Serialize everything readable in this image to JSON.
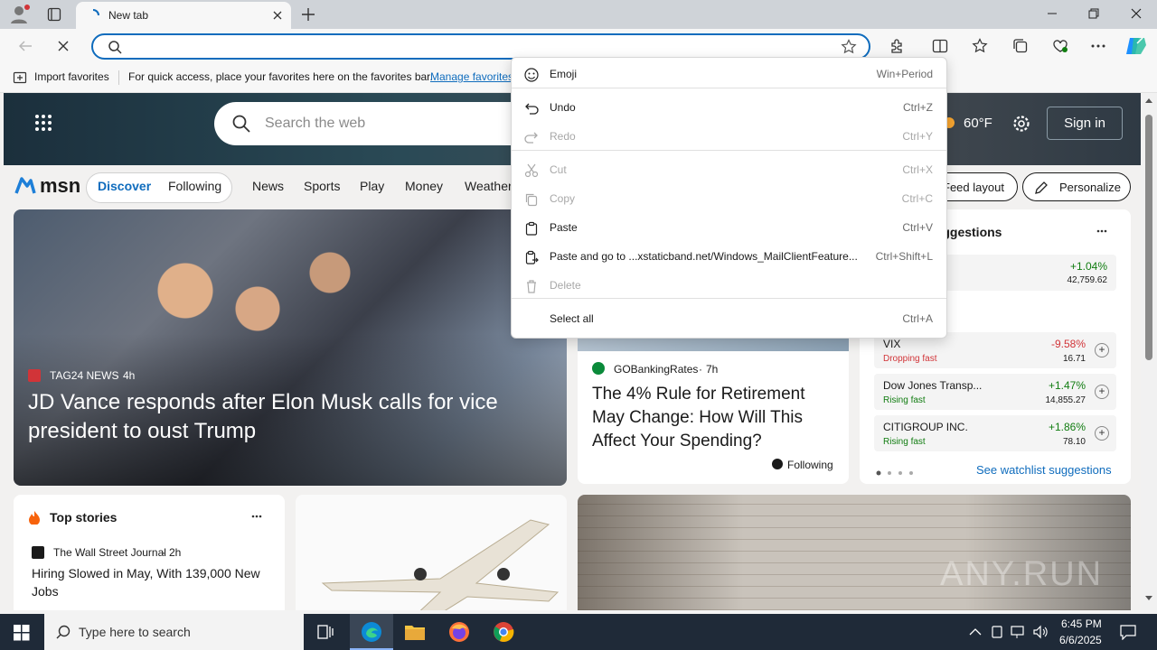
{
  "browser": {
    "tab_title": "New tab",
    "address_value": "",
    "favbar": {
      "import": "Import favorites",
      "hint": "For quick access, place your favorites here on the favorites bar.",
      "manage": "Manage favorites"
    }
  },
  "msn": {
    "search_placeholder": "Search the web",
    "weather": "60°F",
    "sign_in": "Sign in",
    "logo": "msn",
    "nav": {
      "discover": "Discover",
      "following": "Following",
      "items": [
        "News",
        "Sports",
        "Play",
        "Money",
        "Weather"
      ]
    },
    "feed_layout": "Feed layout",
    "personalize": "Personalize",
    "main_story": {
      "source": "TAG24 NEWS",
      "age": "4h",
      "headline": "JD Vance responds after Elon Musk calls for vice president to oust Trump"
    },
    "gobanking": {
      "source": "GOBankingRates",
      "age": "7h",
      "headline": "The 4% Rule for Retirement May Change: How Will This Affect Your Spending?",
      "following": "Following"
    },
    "watchlist": {
      "title": "suggestions",
      "first": {
        "change": "+1.04%",
        "value": "42,759.62"
      },
      "items": [
        {
          "name": "VIX",
          "status": "Dropping fast",
          "change": "-9.58%",
          "value": "16.71",
          "color": "#d13438"
        },
        {
          "name": "Dow Jones Transp...",
          "status": "Rising fast",
          "change": "+1.47%",
          "value": "14,855.27",
          "color": "#107c10"
        },
        {
          "name": "CITIGROUP INC.",
          "status": "Rising fast",
          "change": "+1.86%",
          "value": "78.10",
          "color": "#107c10"
        }
      ],
      "see_more": "See watchlist suggestions"
    },
    "top_stories": {
      "title": "Top stories",
      "source": "The Wall Street Journal",
      "age": "2h",
      "headline": "Hiring Slowed in May, With 139,000 New Jobs"
    }
  },
  "context_menu": {
    "items": [
      {
        "label": "Emoji",
        "shortcut": "Win+Period",
        "icon": "emoji-icon"
      },
      {
        "label": "Undo",
        "shortcut": "Ctrl+Z",
        "icon": "undo-icon"
      },
      {
        "label": "Redo",
        "shortcut": "Ctrl+Y",
        "icon": "redo-icon"
      },
      {
        "label": "Cut",
        "shortcut": "Ctrl+X",
        "icon": "cut-icon"
      },
      {
        "label": "Copy",
        "shortcut": "Ctrl+C",
        "icon": "copy-icon"
      },
      {
        "label": "Paste",
        "shortcut": "Ctrl+V",
        "icon": "paste-icon"
      },
      {
        "label": "Paste and go to ...xstaticband.net/Windows_MailClientFeature...",
        "shortcut": "Ctrl+Shift+L",
        "icon": "paste-go-icon"
      },
      {
        "label": "Delete",
        "shortcut": "",
        "icon": "delete-icon"
      },
      {
        "label": "Select all",
        "shortcut": "Ctrl+A",
        "icon": ""
      }
    ]
  },
  "taskbar": {
    "search": "Type here to search",
    "time": "6:45 PM",
    "date": "6/6/2025"
  },
  "watermark": "ANY.RUN",
  "colors": {
    "accent": "#0f6cbd",
    "taskbar": "#1f2a38"
  }
}
